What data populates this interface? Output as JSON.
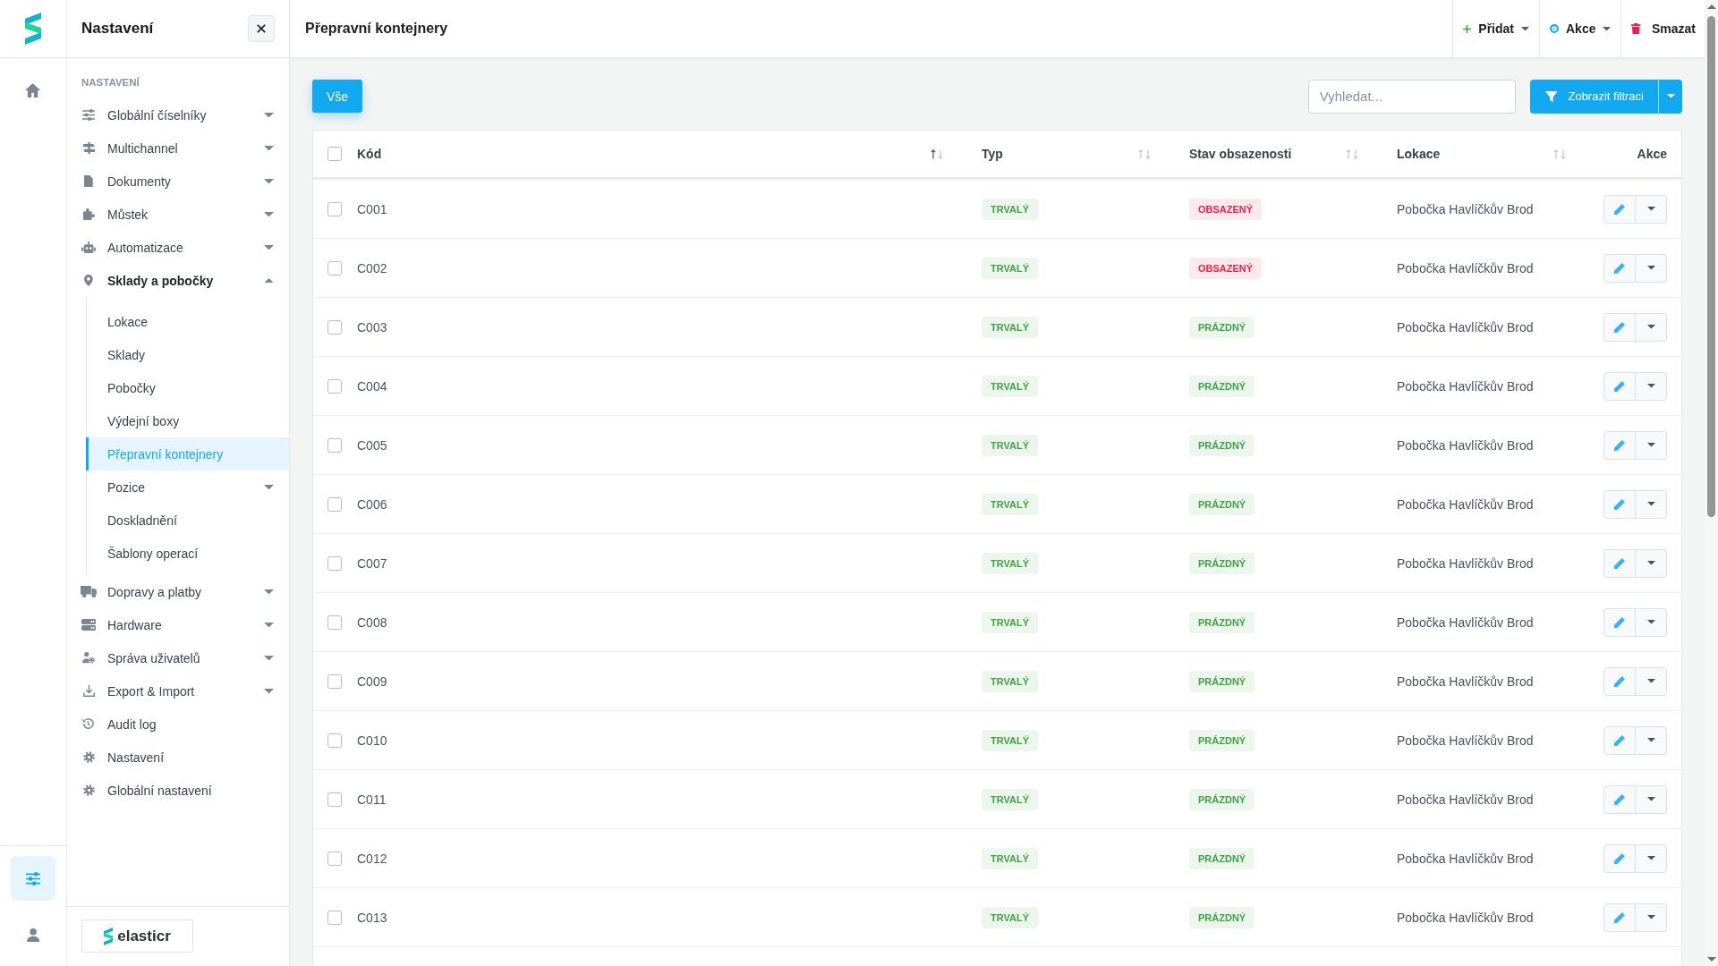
{
  "rail": {
    "top_items": [
      {
        "kind": "home",
        "selected": false
      }
    ],
    "bottom_items": [
      {
        "kind": "sliders",
        "selected": true
      },
      {
        "kind": "user",
        "selected": false
      }
    ]
  },
  "sidebar": {
    "title": "Nastavení",
    "section_label": "NASTAVENÍ",
    "items": [
      {
        "label": "Globální číselníky",
        "kind": "sliders",
        "expanded": false,
        "selected": false
      },
      {
        "label": "Multichannel",
        "kind": "signpost",
        "expanded": false,
        "selected": false
      },
      {
        "label": "Dokumenty",
        "kind": "file",
        "expanded": false,
        "selected": false
      },
      {
        "label": "Můstek",
        "kind": "puzzle",
        "expanded": false,
        "selected": false
      },
      {
        "label": "Automatizace",
        "kind": "robot",
        "expanded": false,
        "selected": false
      },
      {
        "label": "Sklady a pobočky",
        "kind": "pin",
        "expanded": true,
        "selected": false,
        "children": [
          {
            "label": "Lokace",
            "selected": false
          },
          {
            "label": "Sklady",
            "selected": false
          },
          {
            "label": "Pobočky",
            "selected": false
          },
          {
            "label": "Výdejní boxy",
            "selected": false
          },
          {
            "label": "Přepravní kontejnery",
            "selected": true
          },
          {
            "label": "Pozice",
            "expanded": false,
            "selected": false
          },
          {
            "label": "Doskladnění",
            "selected": false
          },
          {
            "label": "Šablony operací",
            "selected": false
          }
        ]
      },
      {
        "label": "Dopravy a platby",
        "kind": "truck",
        "expanded": false,
        "selected": false
      },
      {
        "label": "Hardware",
        "kind": "server",
        "expanded": false,
        "selected": false
      },
      {
        "label": "Správa uživatelů",
        "kind": "usercog",
        "expanded": false,
        "selected": false
      },
      {
        "label": "Export & Import",
        "kind": "download",
        "expanded": false,
        "selected": false
      },
      {
        "label": "Audit log",
        "kind": "history",
        "selected": false
      },
      {
        "label": "Nastavení",
        "kind": "gear",
        "selected": false
      },
      {
        "label": "Globální nastavení",
        "kind": "gear",
        "selected": false
      }
    ],
    "brand": "elasticr"
  },
  "header": {
    "title": "Přepravní kontejnery",
    "actions": [
      {
        "label": "Přidat",
        "kind": "add",
        "dropdown": true
      },
      {
        "label": "Akce",
        "kind": "run",
        "dropdown": true
      },
      {
        "label": "Smazat",
        "kind": "delete",
        "dropdown": false
      }
    ]
  },
  "toolbar": {
    "views": [
      {
        "label": "Vše",
        "selected": true
      }
    ],
    "search": {
      "placeholder": "Vyhledat..."
    },
    "filter_button": {
      "label": "Zobrazit filtraci"
    }
  },
  "table": {
    "select_all": {
      "checked": false
    },
    "columns": [
      {
        "label": "Kód",
        "sorted": true
      },
      {
        "label": "Typ",
        "sorted": false
      },
      {
        "label": "Stav obsazenosti",
        "sorted": false
      },
      {
        "label": "Lokace",
        "sorted": false
      },
      {
        "label": "Akce"
      }
    ],
    "rows": [
      {
        "checked": false,
        "code": "C001",
        "type": {
          "label": "TRVALÝ",
          "color": "#43a047"
        },
        "status": {
          "label": "OBSAZENÝ",
          "color": "#e2234f"
        },
        "location": "Pobočka Havlíčkův Brod"
      },
      {
        "checked": false,
        "code": "C002",
        "type": {
          "label": "TRVALÝ",
          "color": "#43a047"
        },
        "status": {
          "label": "OBSAZENÝ",
          "color": "#e2234f"
        },
        "location": "Pobočka Havlíčkův Brod"
      },
      {
        "checked": false,
        "code": "C003",
        "type": {
          "label": "TRVALÝ",
          "color": "#43a047"
        },
        "status": {
          "label": "PRÁZDNÝ",
          "color": "#43a047"
        },
        "location": "Pobočka Havlíčkův Brod"
      },
      {
        "checked": false,
        "code": "C004",
        "type": {
          "label": "TRVALÝ",
          "color": "#43a047"
        },
        "status": {
          "label": "PRÁZDNÝ",
          "color": "#43a047"
        },
        "location": "Pobočka Havlíčkův Brod"
      },
      {
        "checked": false,
        "code": "C005",
        "type": {
          "label": "TRVALÝ",
          "color": "#43a047"
        },
        "status": {
          "label": "PRÁZDNÝ",
          "color": "#43a047"
        },
        "location": "Pobočka Havlíčkův Brod"
      },
      {
        "checked": false,
        "code": "C006",
        "type": {
          "label": "TRVALÝ",
          "color": "#43a047"
        },
        "status": {
          "label": "PRÁZDNÝ",
          "color": "#43a047"
        },
        "location": "Pobočka Havlíčkův Brod"
      },
      {
        "checked": false,
        "code": "C007",
        "type": {
          "label": "TRVALÝ",
          "color": "#43a047"
        },
        "status": {
          "label": "PRÁZDNÝ",
          "color": "#43a047"
        },
        "location": "Pobočka Havlíčkův Brod"
      },
      {
        "checked": false,
        "code": "C008",
        "type": {
          "label": "TRVALÝ",
          "color": "#43a047"
        },
        "status": {
          "label": "PRÁZDNÝ",
          "color": "#43a047"
        },
        "location": "Pobočka Havlíčkův Brod"
      },
      {
        "checked": false,
        "code": "C009",
        "type": {
          "label": "TRVALÝ",
          "color": "#43a047"
        },
        "status": {
          "label": "PRÁZDNÝ",
          "color": "#43a047"
        },
        "location": "Pobočka Havlíčkův Brod"
      },
      {
        "checked": false,
        "code": "C010",
        "type": {
          "label": "TRVALÝ",
          "color": "#43a047"
        },
        "status": {
          "label": "PRÁZDNÝ",
          "color": "#43a047"
        },
        "location": "Pobočka Havlíčkův Brod"
      },
      {
        "checked": false,
        "code": "C011",
        "type": {
          "label": "TRVALÝ",
          "color": "#43a047"
        },
        "status": {
          "label": "PRÁZDNÝ",
          "color": "#43a047"
        },
        "location": "Pobočka Havlíčkův Brod"
      },
      {
        "checked": false,
        "code": "C012",
        "type": {
          "label": "TRVALÝ",
          "color": "#43a047"
        },
        "status": {
          "label": "PRÁZDNÝ",
          "color": "#43a047"
        },
        "location": "Pobočka Havlíčkův Brod"
      },
      {
        "checked": false,
        "code": "C013",
        "type": {
          "label": "TRVALÝ",
          "color": "#43a047"
        },
        "status": {
          "label": "PRÁZDNÝ",
          "color": "#43a047"
        },
        "location": "Pobočka Havlíčkův Brod"
      }
    ]
  }
}
